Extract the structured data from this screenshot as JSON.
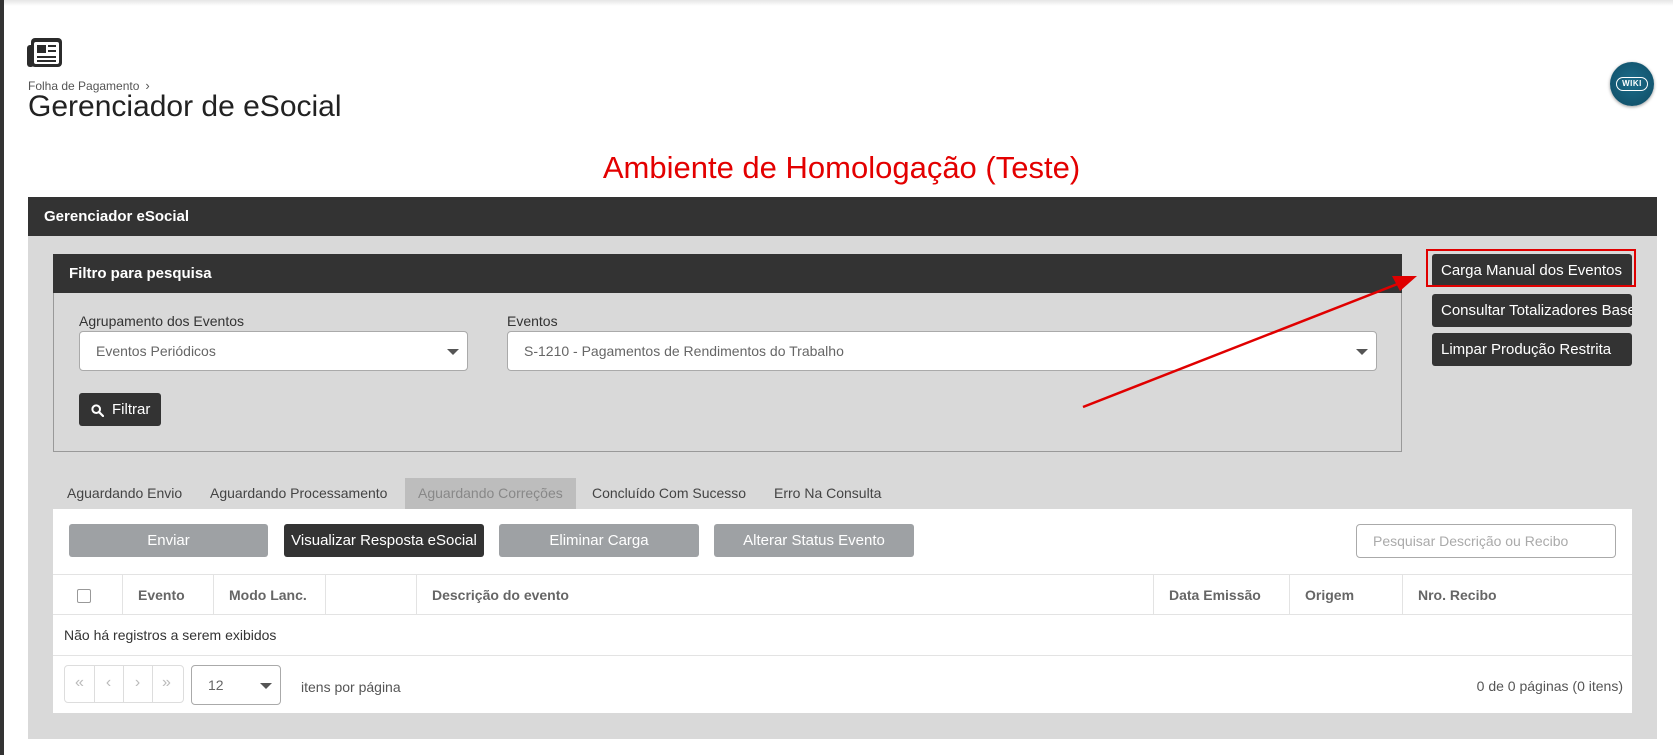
{
  "header": {
    "breadcrumb": "Folha de Pagamento",
    "title": "Gerenciador de eSocial",
    "wiki_label": "WIKI",
    "environment_banner": "Ambiente de Homologação (Teste)"
  },
  "panel": {
    "title": "Gerenciador eSocial"
  },
  "filter": {
    "title": "Filtro para pesquisa",
    "group_label": "Agrupamento dos Eventos",
    "group_value": "Eventos Periódicos",
    "events_label": "Eventos",
    "events_value": "S-1210 - Pagamentos de Rendimentos do Trabalho",
    "filter_button": "Filtrar"
  },
  "side_actions": [
    {
      "label": "Carga Manual dos Eventos"
    },
    {
      "label": "Consultar Totalizadores Base"
    },
    {
      "label": "Limpar Produção Restrita"
    }
  ],
  "tabs": [
    {
      "label": "Aguardando Envio"
    },
    {
      "label": "Aguardando Processamento"
    },
    {
      "label": "Aguardando Correções",
      "active": true
    },
    {
      "label": "Concluído Com Sucesso"
    },
    {
      "label": "Erro Na Consulta"
    }
  ],
  "actions": {
    "send": "Enviar",
    "view_response": "Visualizar Resposta eSocial",
    "delete_load": "Eliminar Carga",
    "change_status": "Alterar Status Evento",
    "search_placeholder": "Pesquisar Descrição ou Recibo"
  },
  "table": {
    "columns": [
      "Evento",
      "Modo Lanc.",
      "",
      "Descrição do evento",
      "Data Emissão",
      "Origem",
      "Nro. Recibo"
    ],
    "empty_message": "Não há registros a serem exibidos"
  },
  "pagination": {
    "first": "«",
    "prev": "‹",
    "next": "›",
    "last": "»",
    "page_size": "12",
    "per_page_label": "itens por página",
    "info": "0 de 0 páginas (0 itens)"
  },
  "colors": {
    "dark": "#333333",
    "panel_bg": "#d9d9d9",
    "banner": "#e30000",
    "disabled_button": "#9ea1a4"
  }
}
